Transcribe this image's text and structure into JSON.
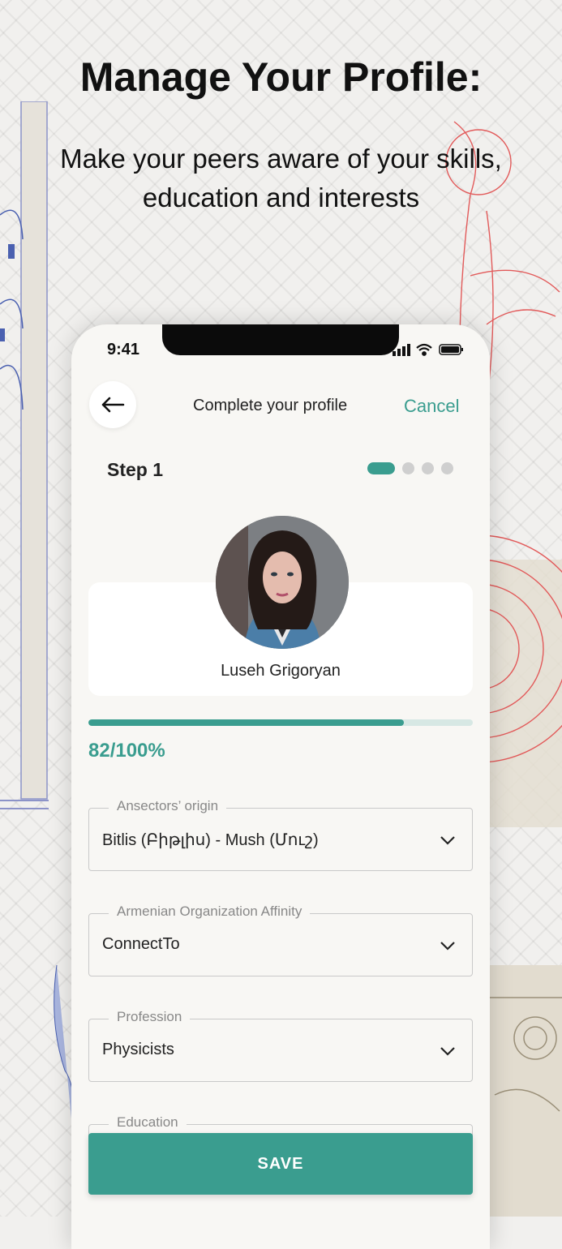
{
  "promo": {
    "headline": "Manage Your Profile:",
    "subline": "Make your peers aware of your skills, education and interests"
  },
  "status_bar": {
    "time": "9:41",
    "icons": [
      "signal-icon",
      "wifi-icon",
      "battery-icon"
    ]
  },
  "nav": {
    "back_icon": "arrow-left-icon",
    "title": "Complete your profile",
    "cancel_label": "Cancel"
  },
  "step": {
    "label": "Step 1",
    "current": 1,
    "total": 4
  },
  "profile": {
    "name": "Luseh Grigoryan"
  },
  "progress": {
    "text": "82/100%",
    "value": 82,
    "max": 100
  },
  "fields": [
    {
      "label": "Ansectors’ origin",
      "value": "Bitlis (Բիթլիս) - Mush (Մուշ)"
    },
    {
      "label": "Armenian Organization Affinity",
      "value": "ConnectTo"
    },
    {
      "label": "Profession",
      "value": "Physicists"
    },
    {
      "label": "Education",
      "value": ""
    }
  ],
  "save_label": "SAVE",
  "colors": {
    "accent": "#3a9d8f",
    "decor_red": "#e25a5a",
    "decor_blue": "#4a60b0"
  }
}
